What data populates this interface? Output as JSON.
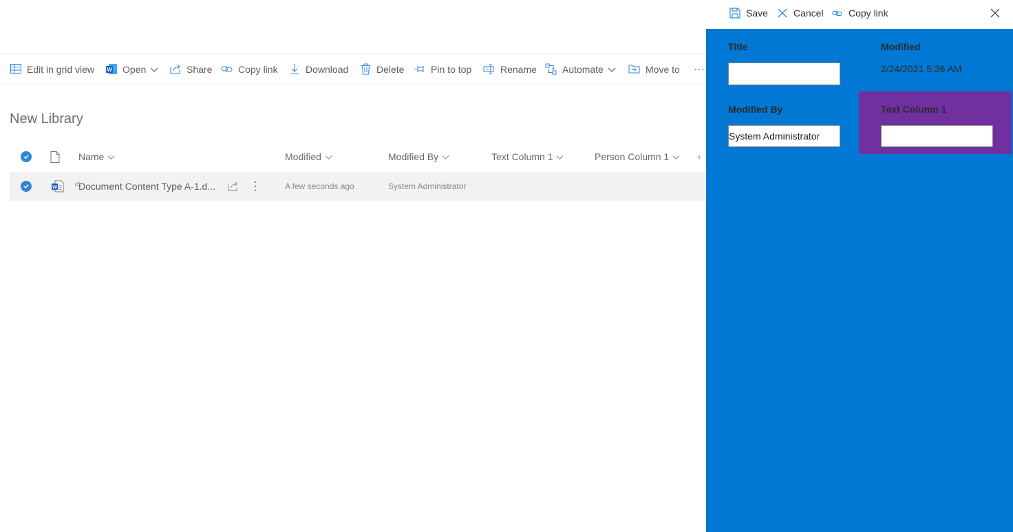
{
  "commandbar": {
    "edit_grid": "Edit in grid view",
    "open": "Open",
    "share": "Share",
    "copy_link": "Copy link",
    "download": "Download",
    "delete": "Delete",
    "pin": "Pin to top",
    "rename": "Rename",
    "automate": "Automate",
    "move_to": "Move to",
    "more": "⋯"
  },
  "library": {
    "title": "New Library",
    "columns": {
      "name": "Name",
      "modified": "Modified",
      "modified_by": "Modified By",
      "text_col": "Text Column 1",
      "person_col": "Person Column 1",
      "add": "+"
    },
    "rows": [
      {
        "name": "Document Content Type A-1.d...",
        "modified": "A few seconds ago",
        "modified_by": "System Administrator"
      }
    ]
  },
  "panel": {
    "save": "Save",
    "cancel": "Cancel",
    "copy_link": "Copy link",
    "fields": {
      "title_label": "Title",
      "title_value": "",
      "modified_label": "Modified",
      "modified_value": "2/24/2021 5:36 AM",
      "modified_by_label": "Modified By",
      "modified_by_value": "System Administrator",
      "text_col_label": "Text Column 1",
      "text_col_value": ""
    },
    "colors": {
      "panel_bg": "#0078d4",
      "highlight": "#7030a0"
    }
  }
}
